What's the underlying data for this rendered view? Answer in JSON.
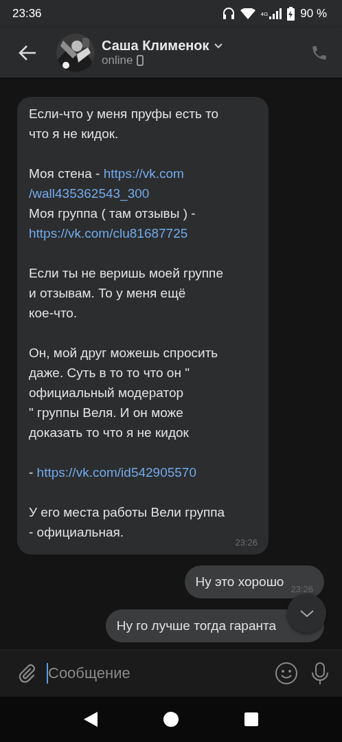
{
  "status_bar": {
    "time": "23:36",
    "network": "4G",
    "battery": "90 %"
  },
  "header": {
    "name": "Саша Клименок",
    "status": "online"
  },
  "incoming": {
    "time": "23:26",
    "paragraphs": [
      [
        [
          {
            "text": "Если-что у меня пруфы есть то"
          }
        ],
        [
          {
            "text": "что я не кидок."
          }
        ]
      ],
      [
        [
          {
            "text": "Моя стена - "
          },
          {
            "text": "https://vk.com",
            "link": true
          }
        ],
        [
          {
            "text": "/wall435362543_300",
            "link": true
          }
        ],
        [
          {
            "text": "Моя группа ( там отзывы ) -"
          }
        ],
        [
          {
            "text": "https://vk.com/clu81687725",
            "link": true
          }
        ]
      ],
      [
        [
          {
            "text": "Если ты не веришь моей группе"
          }
        ],
        [
          {
            "text": "и отзывам. То у меня ещё"
          }
        ],
        [
          {
            "text": "кое-что."
          }
        ]
      ],
      [
        [
          {
            "text": "Он, мой друг можешь спросить"
          }
        ],
        [
          {
            "text": "даже. Суть в то то что он \""
          }
        ],
        [
          {
            "text": "официальный модератор"
          }
        ],
        [
          {
            "text": "\" группы Веля. И он може"
          }
        ],
        [
          {
            "text": "доказать то что я не кидок"
          }
        ]
      ],
      [
        [
          {
            "text": "- "
          },
          {
            "text": "https://vk.com/id542905570",
            "link": true
          }
        ]
      ],
      [
        [
          {
            "text": "У его места работы Вели группа"
          }
        ],
        [
          {
            "text": "- официальная."
          }
        ]
      ]
    ]
  },
  "outgoing": [
    {
      "text": "Ну это хорошо",
      "time": "23:26"
    },
    {
      "text": "Ну го лучше тогда гаранта"
    }
  ],
  "composer": {
    "placeholder": "Сообщение"
  }
}
